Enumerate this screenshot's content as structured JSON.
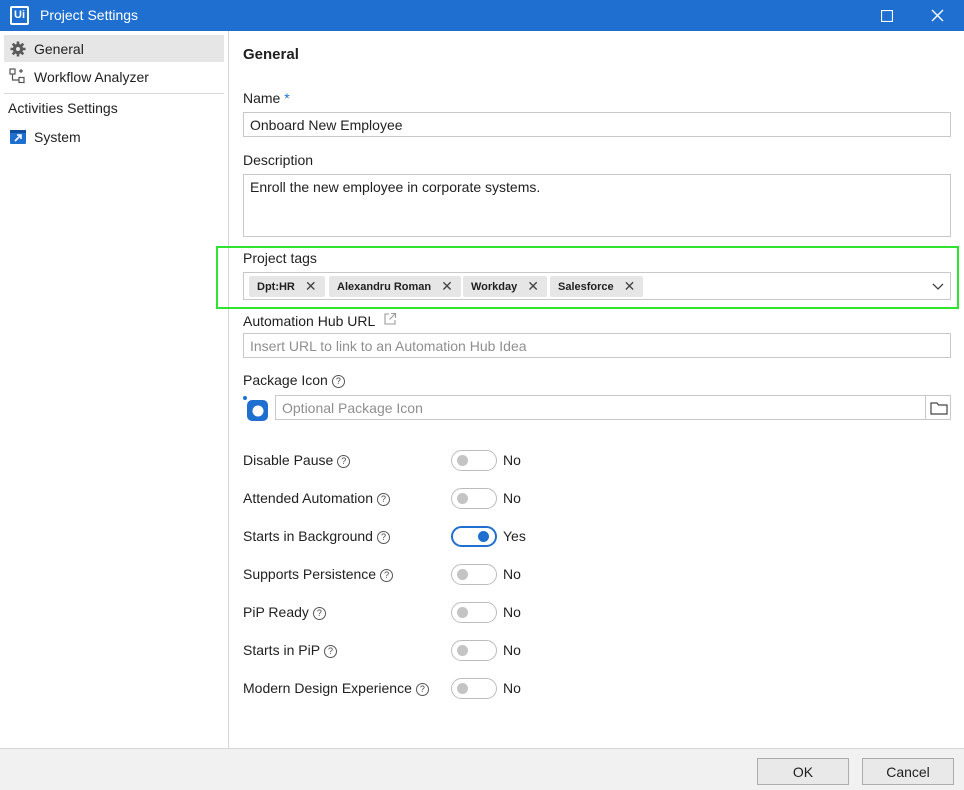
{
  "window": {
    "title": "Project Settings",
    "logo_text": "Ui"
  },
  "sidebar": {
    "items": [
      {
        "label": "General",
        "icon": "gear-icon",
        "selected": true
      },
      {
        "label": "Workflow Analyzer",
        "icon": "workflow-analyzer-icon"
      },
      {
        "label": "Activities Settings"
      },
      {
        "label": "System",
        "icon": "system-icon"
      }
    ]
  },
  "general": {
    "title": "General",
    "name_label": "Name",
    "required_mark": "*",
    "name_value": "Onboard New Employee",
    "description_label": "Description",
    "description_value": "Enroll the new employee in corporate systems.",
    "tags_label": "Project tags",
    "tags": [
      "Dpt:HR",
      "Alexandru Roman",
      "Workday",
      "Salesforce"
    ],
    "hub_url_label": "Automation Hub URL",
    "hub_url_placeholder": "Insert URL to link to an Automation Hub Idea",
    "package_icon_label": "Package Icon",
    "package_icon_placeholder": "Optional Package Icon",
    "help_glyph": "?",
    "toggles": [
      {
        "label": "Disable Pause",
        "value": "No",
        "on": false
      },
      {
        "label": "Attended Automation",
        "value": "No",
        "on": false
      },
      {
        "label": "Starts in Background",
        "value": "Yes",
        "on": true
      },
      {
        "label": "Supports Persistence",
        "value": "No",
        "on": false
      },
      {
        "label": "PiP Ready",
        "value": "No",
        "on": false
      },
      {
        "label": "Starts in PiP",
        "value": "No",
        "on": false
      },
      {
        "label": "Modern Design Experience",
        "value": "No",
        "on": false
      }
    ]
  },
  "footer": {
    "ok_label": "OK",
    "cancel_label": "Cancel"
  },
  "colors": {
    "accent": "#1f6fd1",
    "highlight": "#2ee42e"
  }
}
